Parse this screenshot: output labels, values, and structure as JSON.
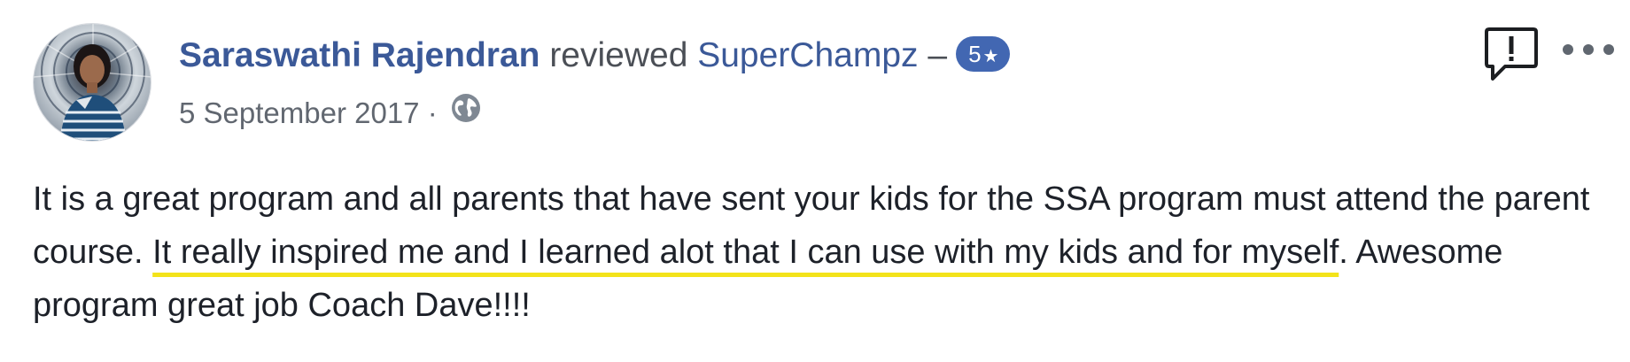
{
  "review": {
    "author": "Saraswathi Rajendran",
    "action": " reviewed ",
    "page": "SuperChampz",
    "dash": " –",
    "rating": "5",
    "rating_star": "★",
    "date": "5 September 2017",
    "separator": " · ",
    "privacy_icon": "globe-icon",
    "actions_icons": [
      "report-icon",
      "more-options-icon"
    ],
    "body": {
      "text_1": "It is a great program and all parents that have sent your kids for the SSA program must attend the parent course. ",
      "highlight": "It really inspired me and I learned alot that I can use with my kids and for myself",
      "text_2": ". Awesome program great job Coach Dave!!!!"
    }
  },
  "colors": {
    "link_blue": "#3b5998",
    "badge_blue": "#4267b2",
    "highlight_underline": "#f3e31a",
    "meta_gray": "#616770",
    "body_text": "#1d2129"
  }
}
